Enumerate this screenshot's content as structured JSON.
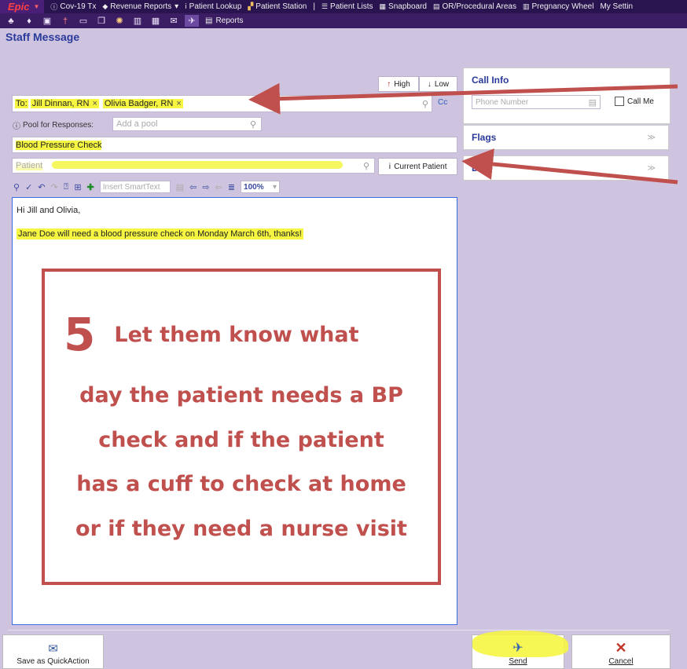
{
  "topbar": {
    "logo": "Epic",
    "items": [
      {
        "icon": "info-circle-icon",
        "glyph": "ⓘ",
        "label": "Cov-19 Tx"
      },
      {
        "icon": "diamond-icon",
        "glyph": "◆",
        "label": "Revenue Reports"
      },
      {
        "icon": "person-icon",
        "glyph": "ⅰ",
        "label": "Patient Lookup"
      },
      {
        "icon": "people-icon",
        "glyph": "▞",
        "label": "Patient Station"
      },
      {
        "icon": "list-icon",
        "glyph": "☰",
        "label": "Patient Lists"
      },
      {
        "icon": "grid-icon",
        "glyph": "▦",
        "label": "Snapboard"
      },
      {
        "icon": "board-icon",
        "glyph": "▤",
        "label": "OR/Procedural Areas"
      },
      {
        "icon": "calendar-icon",
        "glyph": "▥",
        "label": "Pregnancy Wheel"
      },
      {
        "icon": "none",
        "glyph": "",
        "label": "My Settin"
      }
    ],
    "reports_label": "Reports"
  },
  "page_title": "Staff Message",
  "priority": {
    "high_label": "High",
    "low_label": "Low"
  },
  "to": {
    "prefix": "To:",
    "recipients": [
      "Jill Dinnan, RN",
      "Olivia Badger, RN"
    ],
    "cc_label": "Cc"
  },
  "pool": {
    "label": "Pool for Responses:",
    "placeholder": "Add a pool"
  },
  "subject": {
    "value": "Blood Pressure Check"
  },
  "patient": {
    "placeholder": "Patient",
    "current_patient_label": "Current Patient"
  },
  "toolbar": {
    "smarttext_placeholder": "Insert SmartText",
    "zoom": "100%"
  },
  "message": {
    "line1": "Hi Jill and Olivia,",
    "line2": "Jane Doe will need a blood pressure check on Monday March 6th, thanks!"
  },
  "call_info": {
    "title": "Call Info",
    "phone_placeholder": "Phone Number",
    "call_me_label": "Call Me"
  },
  "flags": {
    "title": "Flags"
  },
  "third_panel": {
    "title": "D  f"
  },
  "annotation": {
    "step": "5",
    "lines": [
      "Let them know what",
      "day the patient needs a BP",
      "check and if the patient",
      "has a cuff to check at home",
      "or if they need a nurse visit"
    ]
  },
  "bottom": {
    "quickaction_label": "Save as QuickAction",
    "send_label": "Send",
    "cancel_label": "Cancel"
  },
  "colors": {
    "accent": "#2a3a9c",
    "highlight": "#f5f542",
    "annotation": "#c0504d",
    "background": "#cfc4df"
  }
}
